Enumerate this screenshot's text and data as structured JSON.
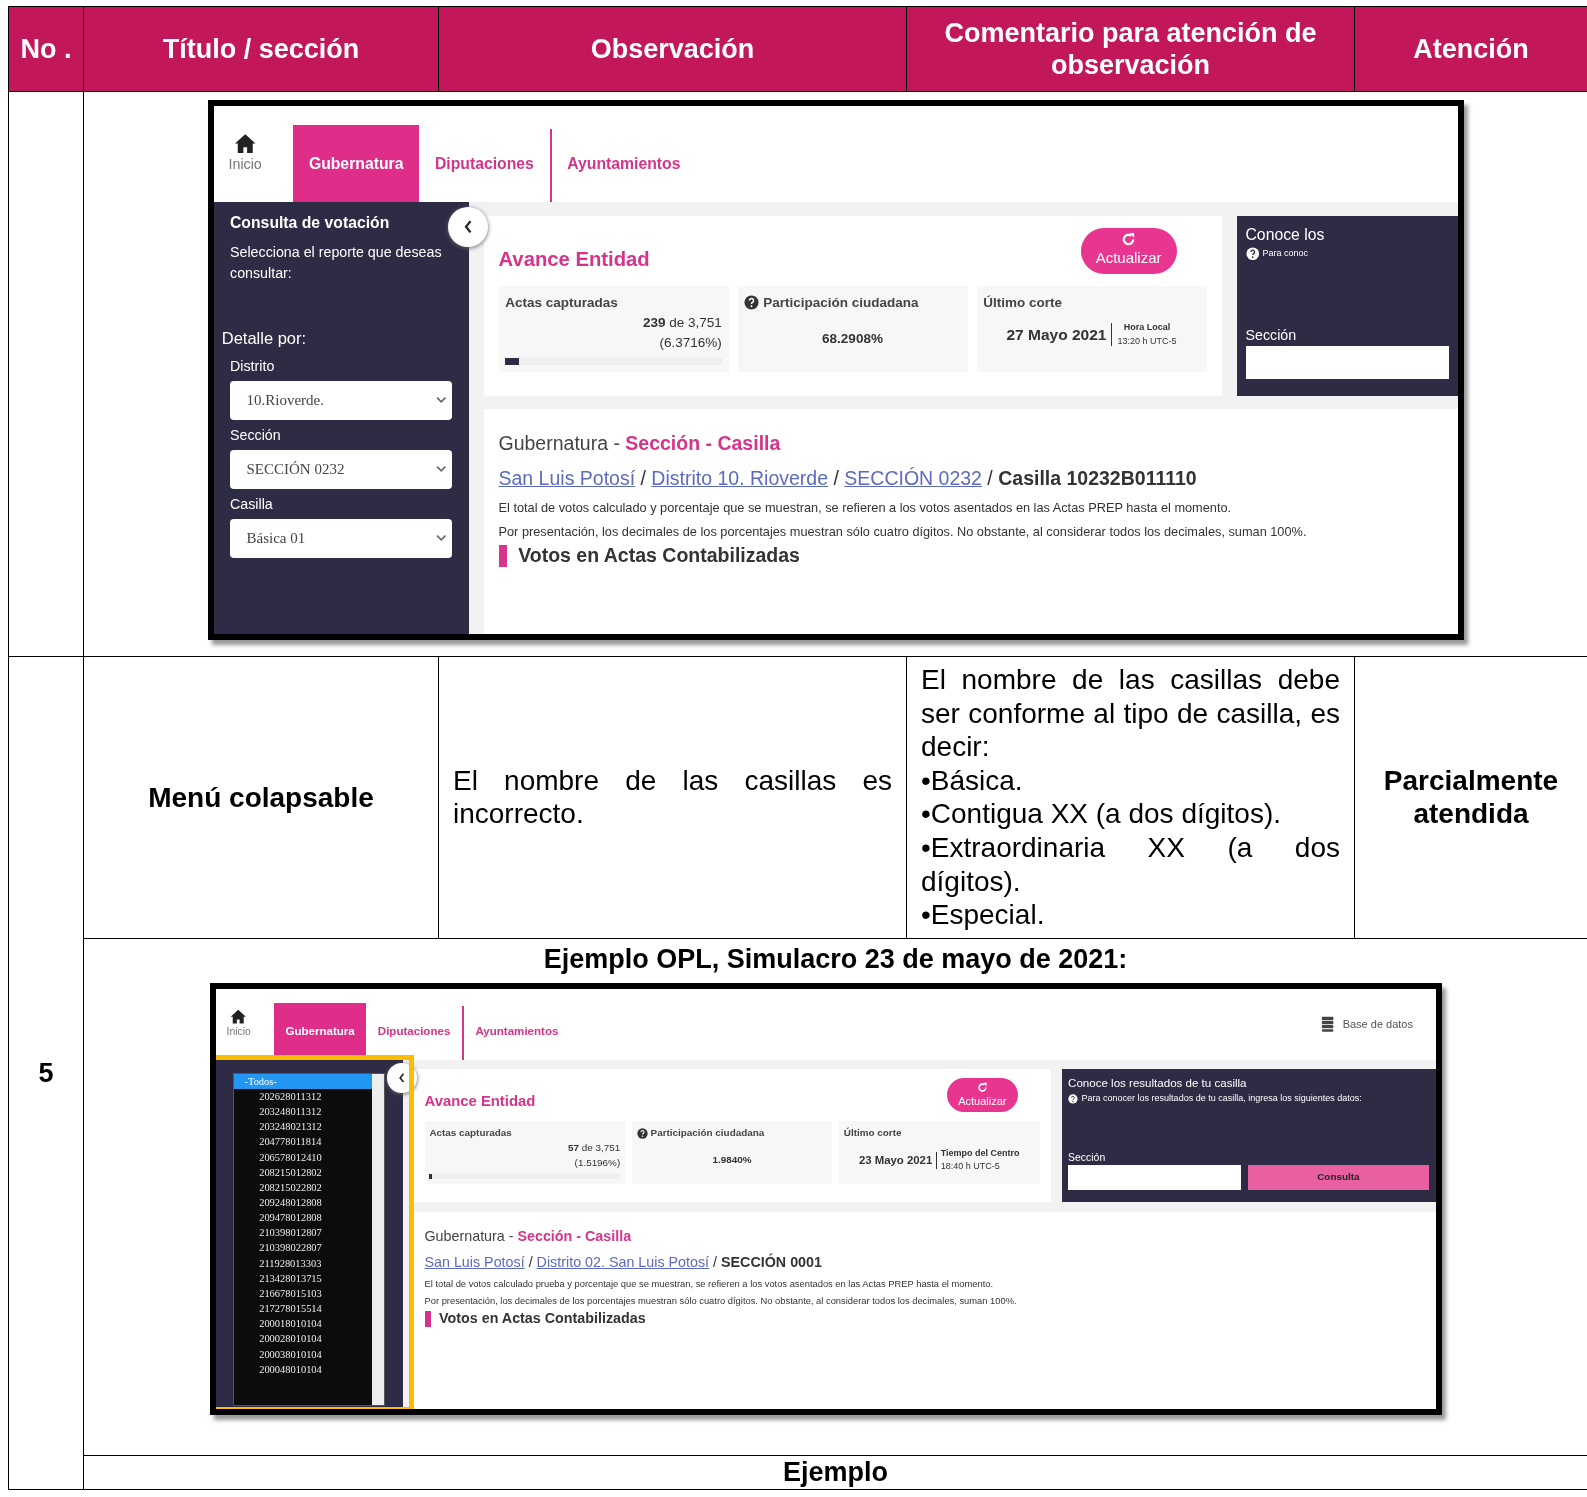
{
  "table": {
    "columns": [
      "No .",
      "Título / sección",
      "Observación",
      "Comentario para atención de observación",
      "Atención"
    ],
    "rows": [
      {
        "kind": "screenshot",
        "screenshot": {
          "nav": {
            "home": "Inicio",
            "tabs": [
              {
                "label": "Gubernatura",
                "selected": true
              },
              {
                "label": "Diputaciones",
                "selected": false
              },
              {
                "label": "Ayuntamientos",
                "selected": false
              }
            ]
          },
          "sidebar": {
            "title": "Consulta de votación",
            "subtitle": "Selecciona el reporte que deseas consultar:",
            "detail": "Detalle por:",
            "fields": [
              {
                "label": "Distrito",
                "value": "10.Rioverde."
              },
              {
                "label": "Sección",
                "value": "SECCIÓN 0232"
              },
              {
                "label": "Casilla",
                "value": "Básica 01"
              }
            ]
          },
          "avance": {
            "title": "Avance Entidad",
            "button": "Actualizar",
            "actas": {
              "label": "Actas capturadas",
              "count": "239",
              "total": "de 3,751",
              "percent": "(6.3716%)",
              "level": 0.064
            },
            "participacion": {
              "label": "Participación ciudadana",
              "value": "68.2908%"
            },
            "corte": {
              "label": "Último corte",
              "date": "27 Mayo 2021",
              "time_label": "Hora Local",
              "time": "13:20 h UTC-5"
            }
          },
          "panel": {
            "title": "Conoce los",
            "hint": "Para conoc",
            "field_label": "Sección"
          },
          "results": {
            "heading": "Gubernatura -",
            "heading_highlight": "Sección - Casilla",
            "separator": "/",
            "breadcrumb": [
              "San Luis Potosí",
              "Distrito 10. Rioverde",
              "SECCIÓN 0232"
            ],
            "current": "Casilla 10232B011110",
            "notes": [
              "El total de votos calculado y porcentaje que se muestran, se refieren a los votos asentados en las Actas PREP hasta el momento.",
              "Por presentación, los decimales de los porcentajes muestran sólo cuatro dígitos. No obstante, al considerar todos los decimales, suman 100%."
            ],
            "section_title": "Votos en Actas Contabilizadas"
          }
        }
      },
      {
        "kind": "text",
        "no": "5",
        "title": "Menú colapsable",
        "observation": "El nombre de las casillas es incorrecto.",
        "comment": [
          "El nombre de las casillas debe ser conforme al tipo de casilla, es decir:",
          "•Básica.",
          "•Contigua XX (a dos dígitos).",
          "•Extraordinaria XX (a dos dígitos).",
          "•Especial."
        ],
        "attention": "Parcialmente atendida"
      },
      {
        "kind": "example",
        "caption": "Ejemplo OPL, Simulacro 23 de mayo de 2021:",
        "screenshot": {
          "nav": {
            "home": "Inicio",
            "tabs": [
              {
                "label": "Gubernatura",
                "selected": true
              },
              {
                "label": "Diputaciones",
                "selected": false
              },
              {
                "label": "Ayuntamientos",
                "selected": false
              }
            ],
            "database": "Base de datos"
          },
          "sidebar": {
            "dropdown": {
              "highlighted": true,
              "options": [
                {
                  "label": "-Todos-",
                  "selected": true
                },
                {
                  "label": "202628011312",
                  "selected": false
                },
                {
                  "label": "203248011312",
                  "selected": false
                },
                {
                  "label": "203248021312",
                  "selected": false
                },
                {
                  "label": "204778011814",
                  "selected": false
                },
                {
                  "label": "206578012410",
                  "selected": false
                },
                {
                  "label": "208215012802",
                  "selected": false
                },
                {
                  "label": "208215022802",
                  "selected": false
                },
                {
                  "label": "209248012808",
                  "selected": false
                },
                {
                  "label": "209478012808",
                  "selected": false
                },
                {
                  "label": "210398012807",
                  "selected": false
                },
                {
                  "label": "210398022807",
                  "selected": false
                },
                {
                  "label": "211928013303",
                  "selected": false
                },
                {
                  "label": "213428013715",
                  "selected": false
                },
                {
                  "label": "216678015103",
                  "selected": false
                },
                {
                  "label": "217278015514",
                  "selected": false
                },
                {
                  "label": "200018010104",
                  "selected": false
                },
                {
                  "label": "200028010104",
                  "selected": false
                },
                {
                  "label": "200038010104",
                  "selected": false
                },
                {
                  "label": "200048010104",
                  "selected": false
                }
              ]
            }
          },
          "avance": {
            "title": "Avance Entidad",
            "button": "Actualizar",
            "actas": {
              "label": "Actas capturadas",
              "count": "57",
              "total": "de 3,751",
              "percent": "(1.5196%)",
              "level": 0.015
            },
            "participacion": {
              "label": "Participación ciudadana",
              "value": "1.9840%"
            },
            "corte": {
              "label": "Último corte",
              "date": "23 Mayo 2021",
              "time_label": "Tiempo del Centro",
              "time": "18:40 h UTC-5"
            }
          },
          "panel": {
            "title": "Conoce los resultados de tu casilla",
            "hint": "Para conocer los resultados de tu casilla, ingresa los siguientes datos:",
            "field_label": "Sección",
            "button": "Consulta"
          },
          "results": {
            "heading": "Gubernatura -",
            "heading_highlight": "Sección - Casilla",
            "separator": "/",
            "breadcrumb": [
              "San Luis Potosí",
              "Distrito 02. San Luis Potosí"
            ],
            "current": "SECCIÓN 0001",
            "notes": [
              "El total de votos calculado prueba y porcentaje que se muestran, se refieren a los votos asentados en las Actas PREP hasta el momento.",
              "Por presentación, los decimales de los porcentajes muestran sólo cuatro dígitos. No obstante, al considerar todos los decimales, suman 100%."
            ],
            "section_title": "Votos en Actas Contabilizadas"
          }
        }
      },
      {
        "kind": "caption",
        "caption": "Ejemplo"
      }
    ]
  }
}
